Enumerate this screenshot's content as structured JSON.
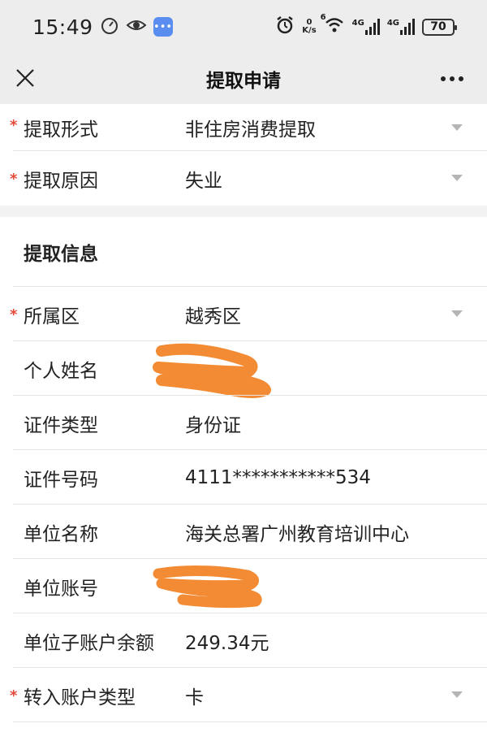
{
  "status_bar": {
    "time": "15:49",
    "net_speed_value": "0",
    "net_speed_unit": "K/s",
    "signal_1": "4G",
    "signal_2": "4G",
    "wifi_sup": "6",
    "battery": "70",
    "icons": [
      "speedometer-icon",
      "eye-icon",
      "chat-icon",
      "alarm-icon",
      "wifi-icon",
      "signal-icon",
      "battery-icon"
    ]
  },
  "nav": {
    "title": "提取申请",
    "close_icon": "close-icon",
    "more_icon": "more-icon"
  },
  "form_top": [
    {
      "label": "提取形式",
      "value": "非住房消费提取",
      "required": true,
      "dropdown": true
    },
    {
      "label": "提取原因",
      "value": "失业",
      "required": true,
      "dropdown": true
    }
  ],
  "section": {
    "title": "提取信息"
  },
  "form_info": [
    {
      "label": "所属区",
      "value": "越秀区",
      "required": true,
      "dropdown": true
    },
    {
      "label": "个人姓名",
      "value": "",
      "required": false,
      "dropdown": false,
      "redacted": true
    },
    {
      "label": "证件类型",
      "value": "身份证",
      "required": false,
      "dropdown": false
    },
    {
      "label": "证件号码",
      "value": "4111***********534",
      "required": false,
      "dropdown": false
    },
    {
      "label": "单位名称",
      "value": "海关总署广州教育培训中心",
      "required": false,
      "dropdown": false
    },
    {
      "label": "单位账号",
      "value": "",
      "required": false,
      "dropdown": false,
      "redacted": true
    },
    {
      "label": "单位子账户余额",
      "value": "249.34元",
      "required": false,
      "dropdown": false
    },
    {
      "label": "转入账户类型",
      "value": "卡",
      "required": true,
      "dropdown": true
    }
  ],
  "colors": {
    "required_star": "#e24a3b",
    "redaction": "#f28b33",
    "header_bg": "#ededed",
    "caret": "#b5b5b5"
  }
}
